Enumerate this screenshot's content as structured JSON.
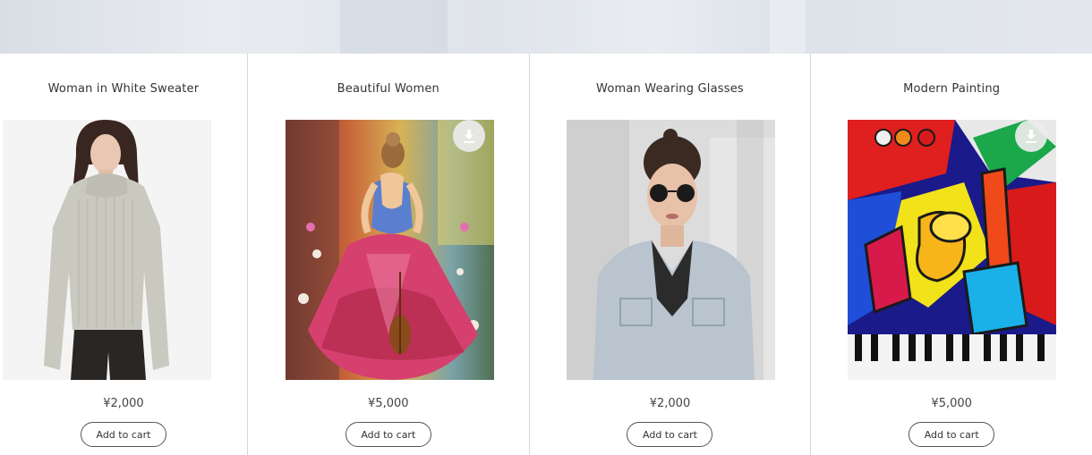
{
  "products": [
    {
      "title": "Woman in White Sweater",
      "price": "¥2,000",
      "cart_label": "Add to cart",
      "image_icon": "sweater-photo",
      "has_download": false
    },
    {
      "title": "Beautiful Women",
      "price": "¥5,000",
      "cart_label": "Add to cart",
      "image_icon": "dancer-painting",
      "has_download": true
    },
    {
      "title": "Woman Wearing Glasses",
      "price": "¥2,000",
      "cart_label": "Add to cart",
      "image_icon": "glasses-photo",
      "has_download": false
    },
    {
      "title": "Modern Painting",
      "price": "¥5,000",
      "cart_label": "Add to cart",
      "image_icon": "abstract-painting",
      "has_download": true
    }
  ],
  "icons": {
    "download": "download-icon"
  },
  "colors": {
    "border": "#d8d8d8",
    "text": "#333333",
    "hero": "#e3e7ed"
  }
}
